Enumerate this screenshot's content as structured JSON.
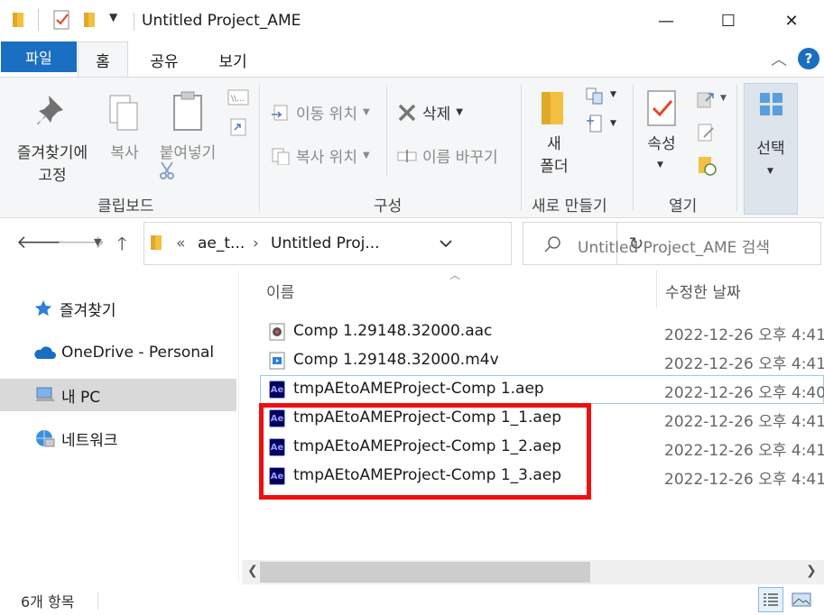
{
  "window": {
    "title": "Untitled Project_AME",
    "minimize_glyph": "—",
    "maximize_glyph": "☐",
    "close_glyph": "✕"
  },
  "ribbon_tabs": {
    "file": "파일",
    "home": "홈",
    "share": "공유",
    "view": "보기"
  },
  "ribbon": {
    "pin": "즐겨찾기에\n고정",
    "pin_line1": "즐겨찾기에",
    "pin_line2": "고정",
    "copy": "복사",
    "paste": "붙여넣기",
    "clipboard_label": "클립보드",
    "move_to": "이동 위치",
    "copy_to": "복사 위치",
    "delete": "삭제",
    "rename": "이름 바꾸기",
    "organize_label": "구성",
    "new_folder_line1": "새",
    "new_folder_line2": "폴더",
    "new_label": "새로 만들기",
    "properties": "속성",
    "open_label": "열기",
    "select": "선택"
  },
  "address": {
    "prefix": "«",
    "crumb1": "ae_t...",
    "crumb2": "Untitled Proj...",
    "search_placeholder": "Untitled Project_AME 검색"
  },
  "nav": {
    "items": [
      {
        "label": "즐겨찾기",
        "icon": "star-icon"
      },
      {
        "label": "OneDrive - Personal",
        "icon": "cloud-icon"
      },
      {
        "label": "내 PC",
        "icon": "computer-icon",
        "selected": true
      },
      {
        "label": "네트워크",
        "icon": "network-icon"
      }
    ]
  },
  "columns": {
    "name": "이름",
    "date": "수정한 날짜"
  },
  "files": [
    {
      "name": "Comp 1.29148.32000.aac",
      "date": "2022-12-26 오후 4:41",
      "icon": "audio-file-icon"
    },
    {
      "name": "Comp 1.29148.32000.m4v",
      "date": "2022-12-26 오후 4:41",
      "icon": "video-file-icon"
    },
    {
      "name": "tmpAEtoAMEProject-Comp 1.aep",
      "date": "2022-12-26 오후 4:40",
      "icon": "after-effects-icon"
    },
    {
      "name": "tmpAEtoAMEProject-Comp 1_1.aep",
      "date": "2022-12-26 오후 4:41",
      "icon": "after-effects-icon"
    },
    {
      "name": "tmpAEtoAMEProject-Comp 1_2.aep",
      "date": "2022-12-26 오후 4:41",
      "icon": "after-effects-icon"
    },
    {
      "name": "tmpAEtoAMEProject-Comp 1_3.aep",
      "date": "2022-12-26 오후 4:41",
      "icon": "after-effects-icon"
    }
  ],
  "ae_badge": "Ae",
  "status": {
    "count": "6개 항목"
  },
  "colors": {
    "accent": "#1a6fc2",
    "highlight": "#f00f0f",
    "folder": "#f3c041"
  }
}
